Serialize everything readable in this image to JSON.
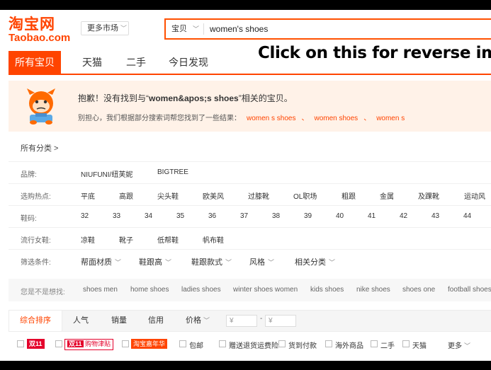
{
  "header": {
    "logo_cn": "淘宝网",
    "logo_en": "Taobao.com",
    "market_label": "更多市场",
    "search_category": "宝贝",
    "search_query": "women's shoes",
    "overlay_text": "Click on this for reverse imag"
  },
  "nav": {
    "tabs": [
      {
        "label": "所有宝贝",
        "active": true
      },
      {
        "label": "天猫",
        "active": false
      },
      {
        "label": "二手",
        "active": false
      },
      {
        "label": "今日发现",
        "active": false
      }
    ]
  },
  "notice": {
    "title_prefix": "抱歉！没有找到与“",
    "title_query": "women&apos;s shoes",
    "title_suffix": "”相关的宝贝。",
    "sub_prefix": "别担心，我们根据部分搜索词帮您找到了一些结果：",
    "suggestions": [
      "women s shoes",
      "women shoes",
      "women s"
    ]
  },
  "all_categories": "所有分类 >",
  "attributes": [
    {
      "label": "品牌:",
      "values": [
        "NIUFUNI/纽芙妮",
        "BIGTREE"
      ]
    },
    {
      "label": "选购热点:",
      "values": [
        "平底",
        "高跟",
        "尖头鞋",
        "欧美风",
        "过膝靴",
        "OL职场",
        "粗跟",
        "金属",
        "及踝靴",
        "运动风"
      ]
    },
    {
      "label": "鞋码:",
      "values": [
        "32",
        "33",
        "34",
        "35",
        "36",
        "37",
        "38",
        "39",
        "40",
        "41",
        "42",
        "43",
        "44"
      ]
    },
    {
      "label": "流行女鞋:",
      "values": [
        "凉鞋",
        "靴子",
        "低帮鞋",
        "帆布鞋"
      ]
    }
  ],
  "filters": {
    "label": "筛选条件:",
    "items": [
      "帮面材质",
      "鞋跟高",
      "鞋跟款式",
      "风格",
      "相关分类"
    ]
  },
  "maybe": {
    "label": "您是不是想找:",
    "items": [
      "shoes men",
      "home shoes",
      "ladies shoes",
      "winter shoes women",
      "kids shoes",
      "nike shoes",
      "shoes one",
      "football shoes"
    ]
  },
  "sort": {
    "tabs": [
      "综合排序",
      "人气",
      "销量",
      "信用",
      "价格"
    ],
    "price_placeholder": "¥",
    "price_dash": "-"
  },
  "checkbox_filters": {
    "badge_1": "双11",
    "badge_2a": "双11",
    "badge_2b": "购物津贴",
    "badge_3": "淘宝嘉年华",
    "items": [
      "包邮",
      "赠送退货运费险",
      "货到付款",
      "海外商品",
      "二手",
      "天猫"
    ],
    "more": "更多"
  },
  "colors": {
    "brand_orange": "#ff4400",
    "notice_bg": "#fff2e8",
    "badge_red": "#e4002b"
  }
}
